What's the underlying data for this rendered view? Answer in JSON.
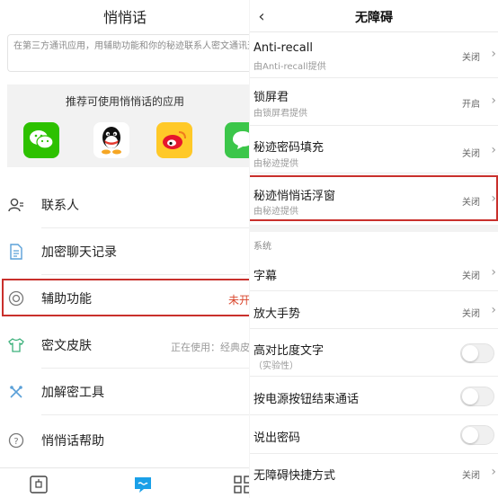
{
  "left": {
    "title": "悄悄话",
    "notice": "在第三方通讯应用，用辅助功能和你的秘迹联系人密文通讯天，长按复制密文即可解密",
    "apps_title": "推荐可使用悄悄话的应用",
    "apps": [
      {
        "name": "wechat-icon",
        "color": "#2dc100"
      },
      {
        "name": "qq-icon",
        "color": "#ffffff"
      },
      {
        "name": "weibo-icon",
        "color": "#ffc928"
      },
      {
        "name": "message-icon",
        "color": "#3cc64a"
      }
    ],
    "menu": [
      {
        "label": "联系人",
        "value": ""
      },
      {
        "label": "加密聊天记录",
        "value": ""
      },
      {
        "label": "辅助功能",
        "value": "未开"
      },
      {
        "label": "密文皮肤",
        "value": "正在使用：经典皮"
      },
      {
        "label": "加解密工具",
        "value": ""
      },
      {
        "label": "悄悄话帮助",
        "value": ""
      }
    ]
  },
  "right": {
    "title": "无障碍",
    "back": "‹",
    "services": [
      {
        "title": "Anti-recall",
        "sub": "由Anti-recall提供",
        "value": "关闭"
      },
      {
        "title": "锁屏君",
        "sub": "由锁屏君提供",
        "value": "开启"
      },
      {
        "title": "秘迹密码填充",
        "sub": "由秘迹提供",
        "value": "关闭"
      },
      {
        "title": "秘迹悄悄话浮窗",
        "sub": "由秘迹提供",
        "value": "关闭"
      }
    ],
    "section_label": "系统",
    "system": [
      {
        "title": "字幕",
        "sub": "",
        "value": "关闭",
        "kind": "link"
      },
      {
        "title": "放大手势",
        "sub": "",
        "value": "关闭",
        "kind": "link"
      },
      {
        "title": "高对比度文字",
        "sub": "（实验性）",
        "value": "",
        "kind": "toggle",
        "on": false
      },
      {
        "title": "按电源按钮结束通话",
        "sub": "",
        "value": "",
        "kind": "toggle",
        "on": false
      },
      {
        "title": "说出密码",
        "sub": "",
        "value": "",
        "kind": "toggle",
        "on": false
      },
      {
        "title": "无障碍快捷方式",
        "sub": "",
        "value": "关闭",
        "kind": "link"
      }
    ]
  },
  "colors": {
    "highlight": "#c9302c",
    "accent": "#1aa0e8",
    "muted": "#9a9a9a"
  }
}
